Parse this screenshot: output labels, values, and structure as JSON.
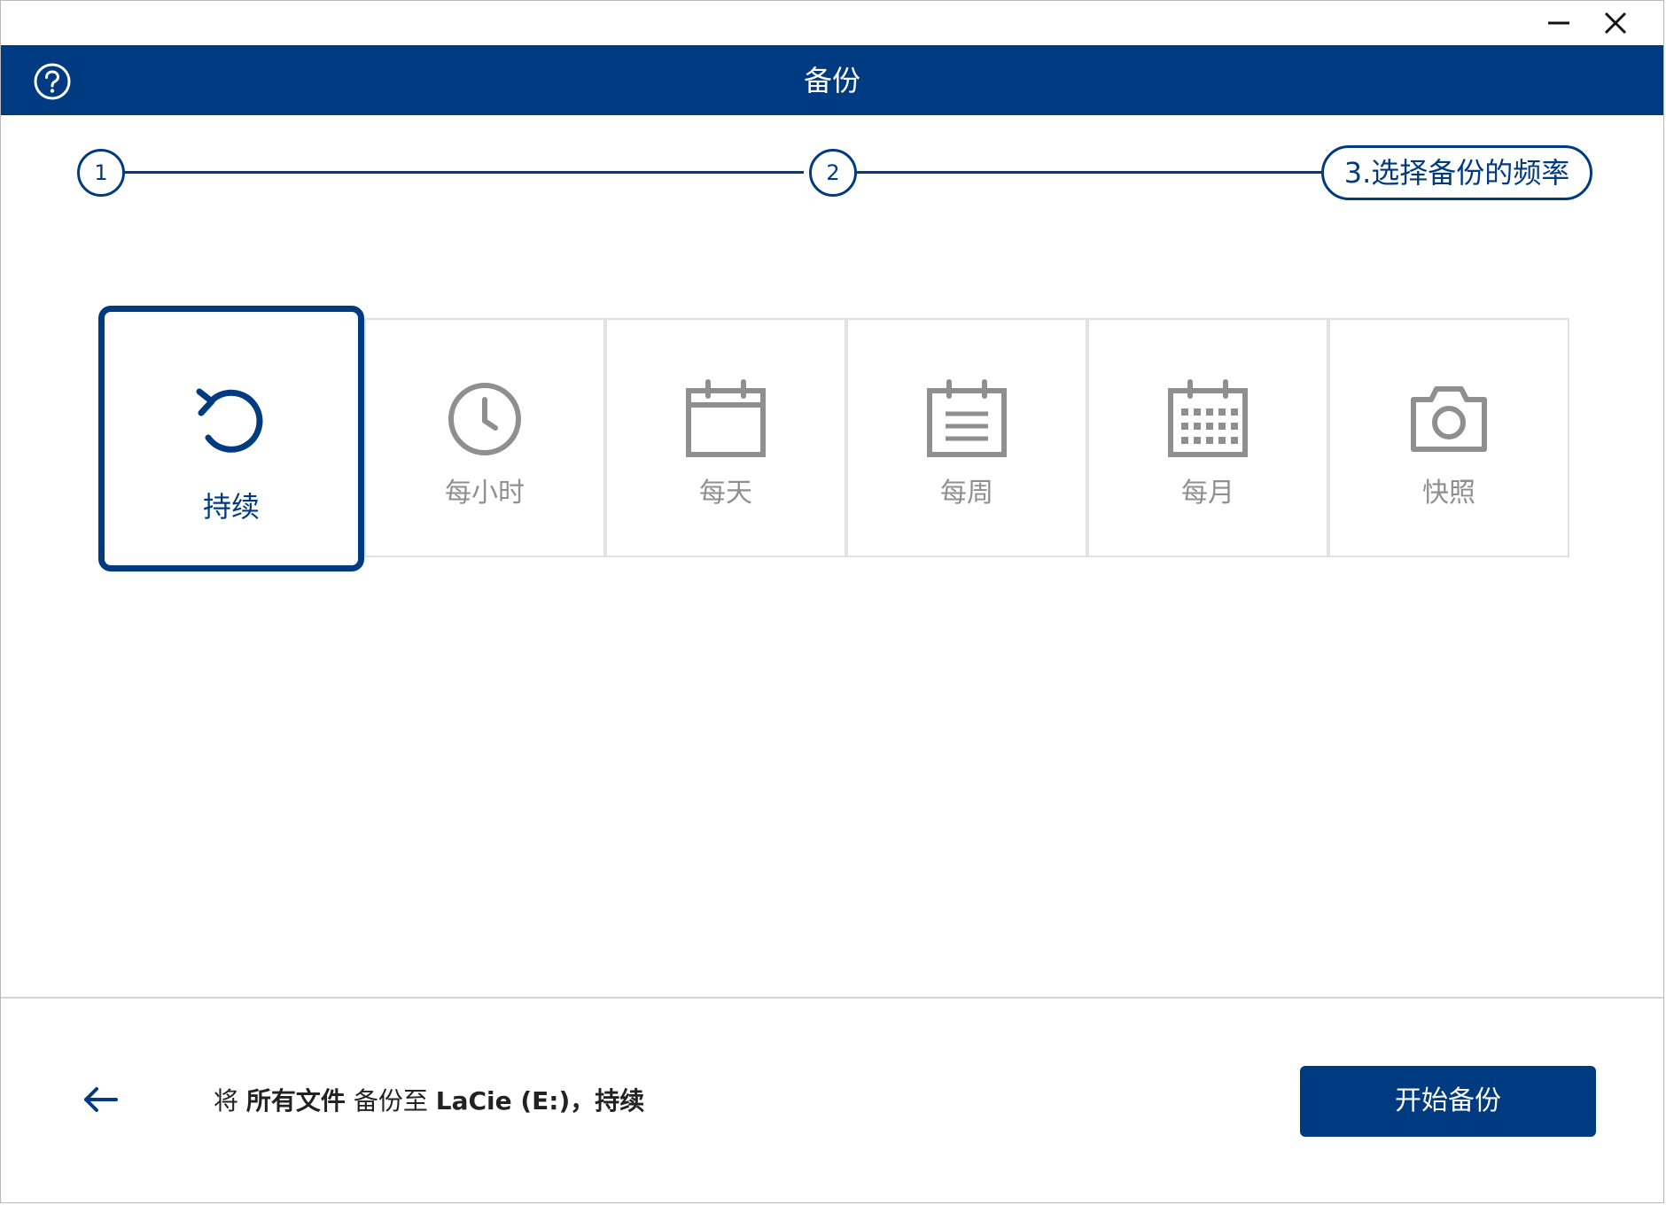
{
  "window": {
    "minimize_icon": "minimize-icon",
    "close_icon": "close-icon"
  },
  "header": {
    "title": "备份",
    "help_icon": "help-icon",
    "background": "#003a80"
  },
  "stepper": {
    "steps": [
      {
        "label": "1",
        "state": "done"
      },
      {
        "label": "2",
        "state": "done"
      },
      {
        "label": "3.选择备份的频率",
        "state": "current"
      }
    ]
  },
  "options": [
    {
      "label": "持续",
      "icon": "continuous-refresh-icon",
      "selected": true
    },
    {
      "label": "每小时",
      "icon": "clock-icon",
      "selected": false
    },
    {
      "label": "每天",
      "icon": "calendar-day-icon",
      "selected": false
    },
    {
      "label": "每周",
      "icon": "calendar-week-icon",
      "selected": false
    },
    {
      "label": "每月",
      "icon": "calendar-month-icon",
      "selected": false
    },
    {
      "label": "快照",
      "icon": "camera-icon",
      "selected": false
    }
  ],
  "footer": {
    "back_icon": "back-arrow-icon",
    "summary": {
      "prefix": "将 ",
      "what": "所有文件",
      "mid": " 备份至 ",
      "target": "LaCie (E:)",
      "sep": "，",
      "frequency": "持续"
    },
    "start_button": "开始备份"
  },
  "colors": {
    "accent": "#003a80",
    "inactive": "#8f8f8f",
    "border": "#e2e2e2"
  }
}
